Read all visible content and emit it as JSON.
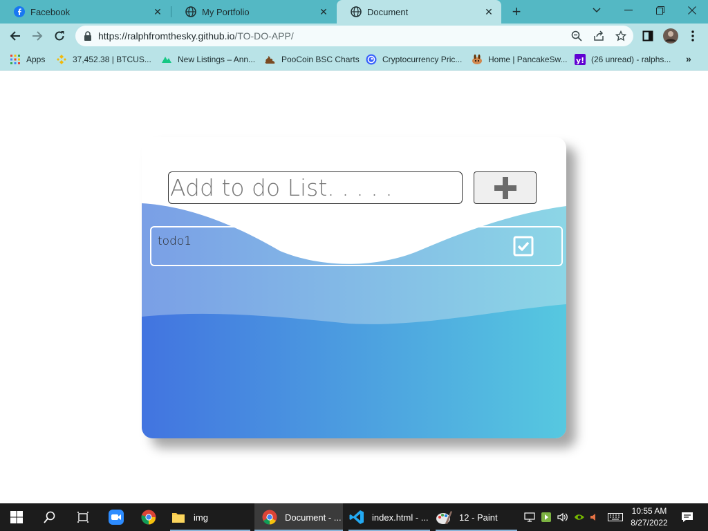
{
  "browser": {
    "tabs": [
      {
        "title": "Facebook",
        "icon": "facebook-icon",
        "active": false
      },
      {
        "title": "My Portfolio",
        "icon": "globe-icon",
        "active": false
      },
      {
        "title": "Document",
        "icon": "globe-icon",
        "active": true
      }
    ],
    "url_host": "https://ralphfromthesky.github.io",
    "url_path": "/TO-DO-APP/",
    "bookmarks": [
      {
        "label": "Apps",
        "icon": "apps-grid-icon"
      },
      {
        "label": "37,452.38  |  BTCUS...",
        "icon": "binance-icon"
      },
      {
        "label": "New Listings – Ann...",
        "icon": "coinmarket-icon"
      },
      {
        "label": "PooCoin BSC Charts",
        "icon": "poocoin-icon"
      },
      {
        "label": "Cryptocurrency Pric...",
        "icon": "coingecko-icon"
      },
      {
        "label": "Home | PancakeSw...",
        "icon": "pancakeswap-icon"
      },
      {
        "label": "(26 unread) - ralphs...",
        "icon": "yahoo-mail-icon"
      }
    ]
  },
  "app": {
    "input_placeholder": "Add to do List. . . . .",
    "todos": [
      {
        "text": "todo1",
        "checked": true
      }
    ],
    "colors": {
      "gradient_start": "#4274e0",
      "gradient_end": "#56c8e0"
    }
  },
  "taskbar": {
    "items": [
      {
        "label": "img",
        "icon": "folder-icon"
      },
      {
        "label": "Document - ...",
        "icon": "chrome-icon"
      },
      {
        "label": "index.html - ...",
        "icon": "vscode-icon"
      },
      {
        "label": "12 - Paint",
        "icon": "paint-icon"
      }
    ],
    "time": "10:55 AM",
    "date": "8/27/2022"
  }
}
